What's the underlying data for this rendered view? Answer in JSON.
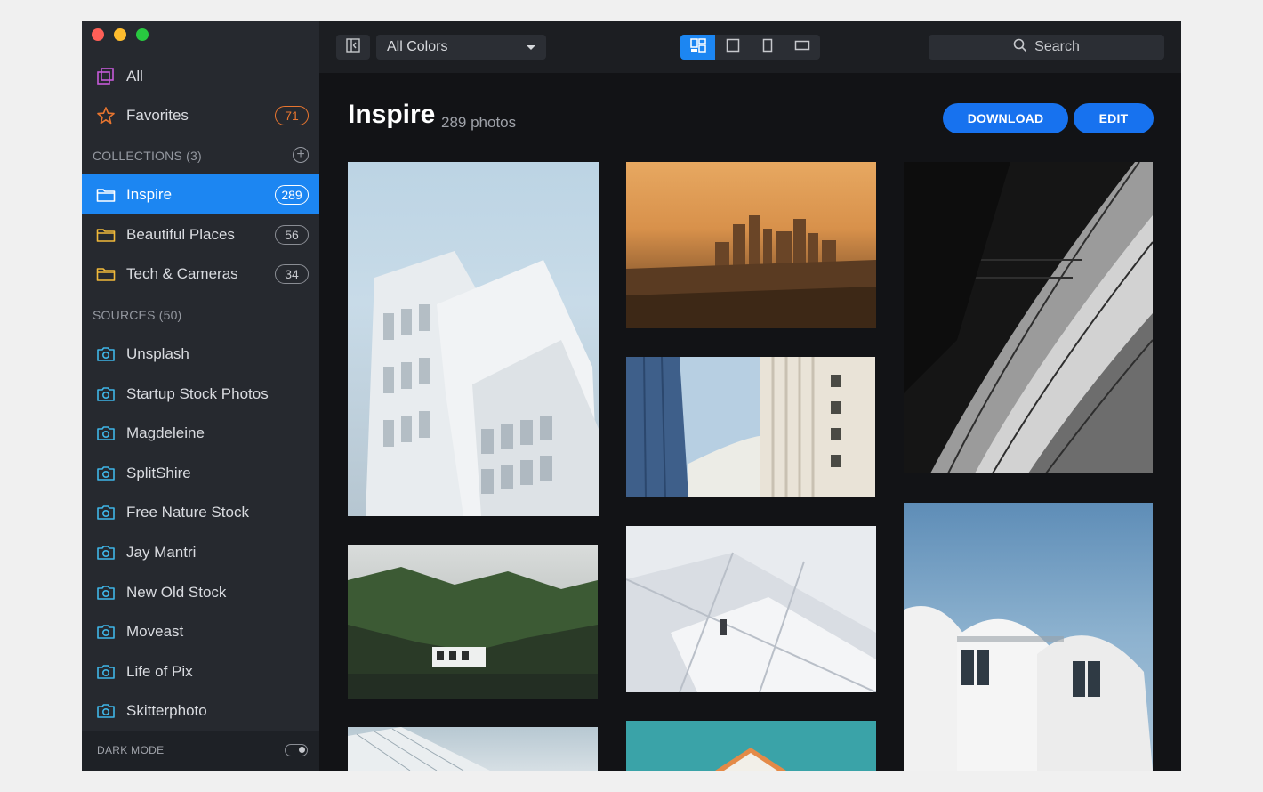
{
  "window": {
    "traffic_lights": [
      "close",
      "minimize",
      "zoom"
    ]
  },
  "sidebar": {
    "top_items": [
      {
        "label": "All",
        "icon": "photos-stack-icon"
      },
      {
        "label": "Favorites",
        "icon": "star-icon",
        "count": "71"
      }
    ],
    "collections_header": "COLLECTIONS (3)",
    "collections": [
      {
        "label": "Inspire",
        "count": "289",
        "active": true
      },
      {
        "label": "Beautiful Places",
        "count": "56"
      },
      {
        "label": "Tech & Cameras",
        "count": "34"
      }
    ],
    "sources_header": "SOURCES (50)",
    "sources": [
      {
        "label": "Unsplash"
      },
      {
        "label": "Startup Stock Photos"
      },
      {
        "label": "Magdeleine"
      },
      {
        "label": "SplitShire"
      },
      {
        "label": "Free Nature Stock"
      },
      {
        "label": "Jay Mantri"
      },
      {
        "label": "New Old Stock"
      },
      {
        "label": "Moveast"
      },
      {
        "label": "Life of Pix"
      },
      {
        "label": "Skitterphoto"
      }
    ],
    "dark_mode_label": "DARK MODE",
    "dark_mode_on": true
  },
  "toolbar": {
    "color_filter": "All Colors",
    "view_modes": [
      "masonry-view-icon",
      "square-view-icon",
      "portrait-view-icon",
      "landscape-view-icon"
    ],
    "active_view": "masonry-view-icon",
    "search_placeholder": "Search"
  },
  "main": {
    "title": "Inspire",
    "subtitle": "289 photos",
    "download_label": "DOWNLOAD",
    "edit_label": "EDIT"
  },
  "colors": {
    "accent": "#1c86f2",
    "favorites_badge": "#e8752f",
    "source_icon": "#3fb6e8"
  }
}
